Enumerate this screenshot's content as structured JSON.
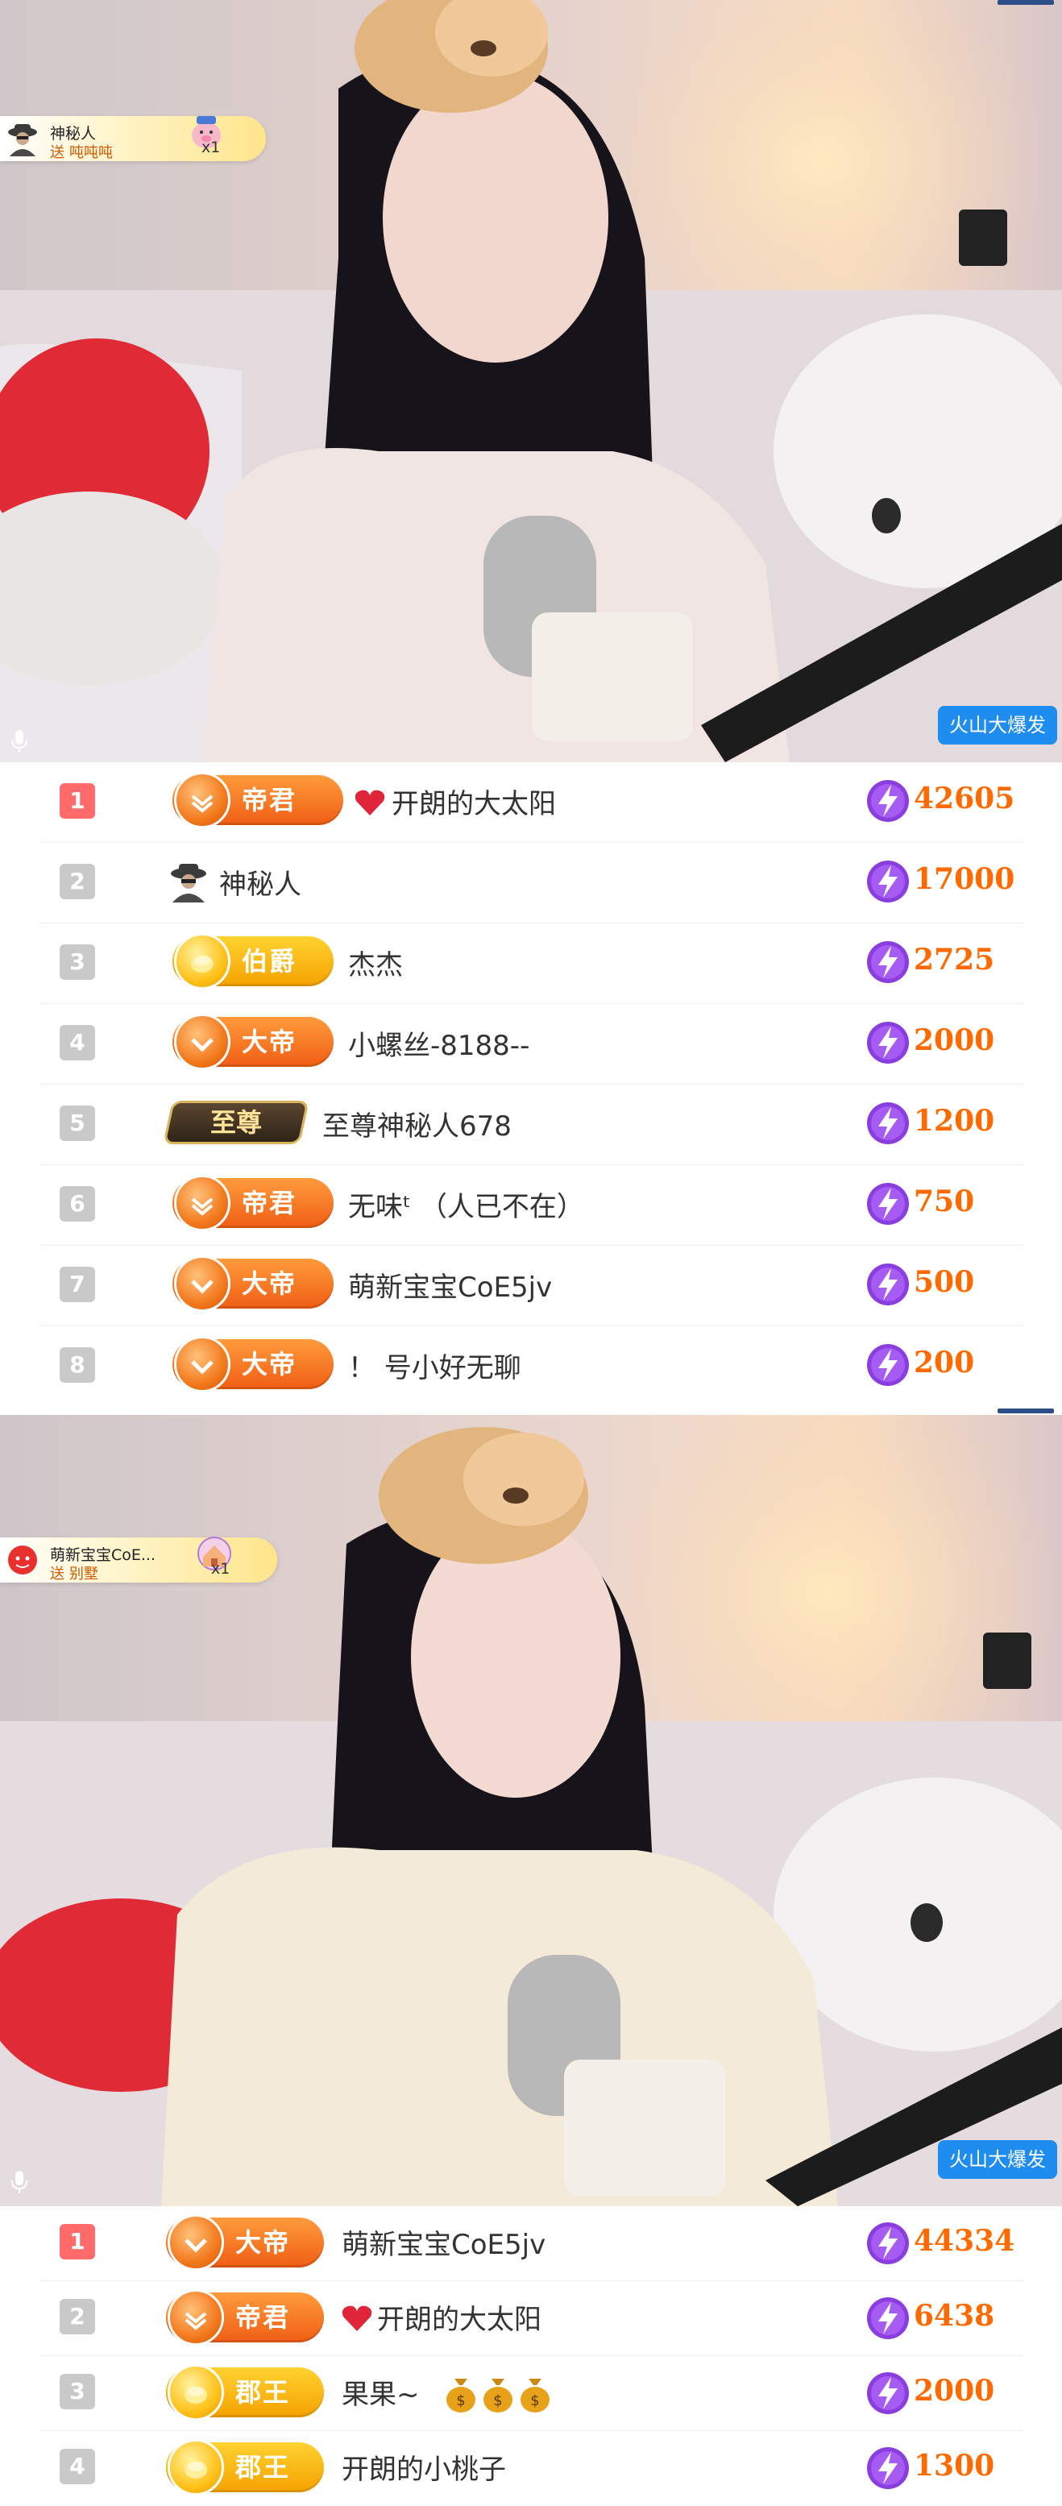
{
  "video1": {
    "toast": {
      "user": "神秘人",
      "action": "送",
      "gift": "吨吨吨",
      "count": "x1"
    },
    "live_badge": "火山大爆发"
  },
  "ranking1": [
    {
      "rank": "1",
      "level": "帝君",
      "level_style": "orange",
      "user": "开朗的大太阳",
      "user_icon": "heart-icon",
      "score": "42605"
    },
    {
      "rank": "2",
      "level": "",
      "level_style": "none",
      "user": "神秘人",
      "user_icon": "spy-icon",
      "score": "17000"
    },
    {
      "rank": "3",
      "level": "伯爵",
      "level_style": "gold",
      "user": "杰杰",
      "user_icon": "",
      "score": "2725"
    },
    {
      "rank": "4",
      "level": "大帝",
      "level_style": "orange",
      "user": "小螺丝-8188--",
      "user_icon": "",
      "score": "2000"
    },
    {
      "rank": "5",
      "level": "至尊",
      "level_style": "zhizun",
      "user": "至尊神秘人678",
      "user_icon": "",
      "score": "1200"
    },
    {
      "rank": "6",
      "level": "帝君",
      "level_style": "orange",
      "user": "无味ᵗ （人已不在）",
      "user_icon": "",
      "score": "750"
    },
    {
      "rank": "7",
      "level": "大帝",
      "level_style": "orange",
      "user": "萌新宝宝CoE5jv",
      "user_icon": "",
      "score": "500"
    },
    {
      "rank": "8",
      "level": "大帝",
      "level_style": "orange",
      "user": "！ 号小好无聊",
      "user_icon": "",
      "score": "200"
    }
  ],
  "video2": {
    "toast": {
      "user": "萌新宝宝CoE...",
      "action": "送",
      "gift": "别墅",
      "count": "x1"
    },
    "live_badge": "火山大爆发"
  },
  "ranking2": [
    {
      "rank": "1",
      "level": "大帝",
      "level_style": "orange",
      "user": "萌新宝宝CoE5jv",
      "user_icon": "",
      "score": "44334"
    },
    {
      "rank": "2",
      "level": "帝君",
      "level_style": "orange",
      "user": "开朗的大太阳",
      "user_icon": "heart-icon",
      "score": "6438"
    },
    {
      "rank": "3",
      "level": "郡王",
      "level_style": "gold",
      "user": "果果~",
      "user_icon": "money-bag-icons",
      "score": "2000"
    },
    {
      "rank": "4",
      "level": "郡王",
      "level_style": "gold",
      "user": "开朗的小桃子",
      "user_icon": "",
      "score": "1300"
    }
  ],
  "colors": {
    "accent": "#ff6a00",
    "rank_first": "#ff6b6b",
    "live_badge": "#1f8cf0"
  }
}
